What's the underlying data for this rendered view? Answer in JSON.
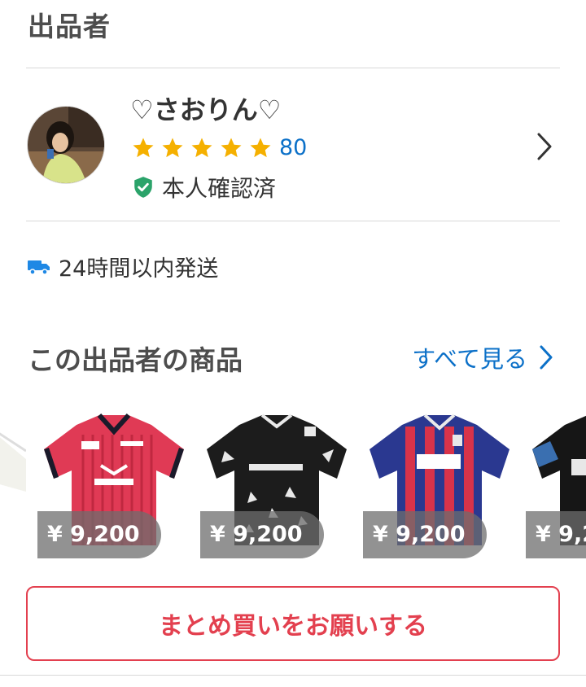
{
  "section": {
    "title": "出品者"
  },
  "seller": {
    "name": "♡さおりん♡",
    "rating_stars": 5,
    "rating_count": "80",
    "verified_label": "本人確認済",
    "icons": {
      "star": "star-icon",
      "verified": "shield-check-icon",
      "chevron": "chevron-right-icon"
    }
  },
  "shipping": {
    "label": "24時間以内発送",
    "icon": "truck-icon"
  },
  "seller_items": {
    "title": "この出品者の商品",
    "see_all_label": "すべて見る",
    "items": [
      {
        "price": "¥ 9,200",
        "description": "red-black striped jersey"
      },
      {
        "price": "¥ 9,200",
        "description": "black jersey"
      },
      {
        "price": "¥ 9,200",
        "description": "blue-red striped jersey"
      },
      {
        "price": "¥ 9,2",
        "description": "black jersey partial"
      }
    ]
  },
  "bulk_button": {
    "label": "まとめ買いをお願いする"
  },
  "colors": {
    "accent_red": "#e3404f",
    "link_blue": "#0b70c8",
    "star_gold": "#f5b000",
    "verified_green": "#2ba36a",
    "truck_blue": "#1e88e5"
  }
}
